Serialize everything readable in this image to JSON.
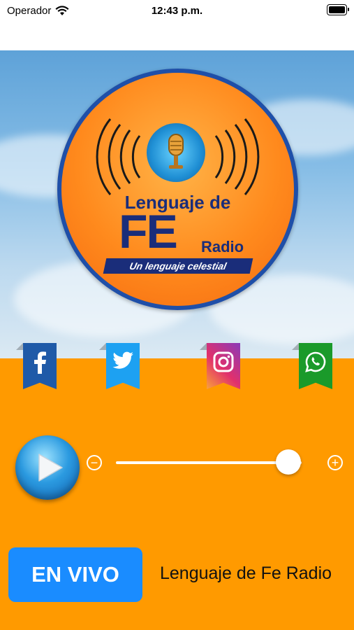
{
  "status_bar": {
    "carrier": "Operador",
    "time": "12:43 p.m."
  },
  "logo": {
    "line1": "Lenguaje de",
    "fe": "FE",
    "radio": "Radio",
    "tagline": "Un lenguaje celestial"
  },
  "social": [
    {
      "name": "facebook",
      "icon": "facebook-icon",
      "color": "#1f5aa8"
    },
    {
      "name": "twitter",
      "icon": "twitter-icon",
      "color": "#1da1f2"
    },
    {
      "name": "instagram",
      "icon": "instagram-icon",
      "color": "#c13584"
    },
    {
      "name": "whatsapp",
      "icon": "whatsapp-icon",
      "color": "#1a9a2a"
    }
  ],
  "player": {
    "volume_level": 0.93
  },
  "bottom": {
    "live_label": "EN VIVO",
    "station_name": "Lenguaje de Fe Radio"
  },
  "colors": {
    "orange_bg": "#ff9a00",
    "live_button": "#1a8cff",
    "logo_blue": "#1a2d7a"
  }
}
